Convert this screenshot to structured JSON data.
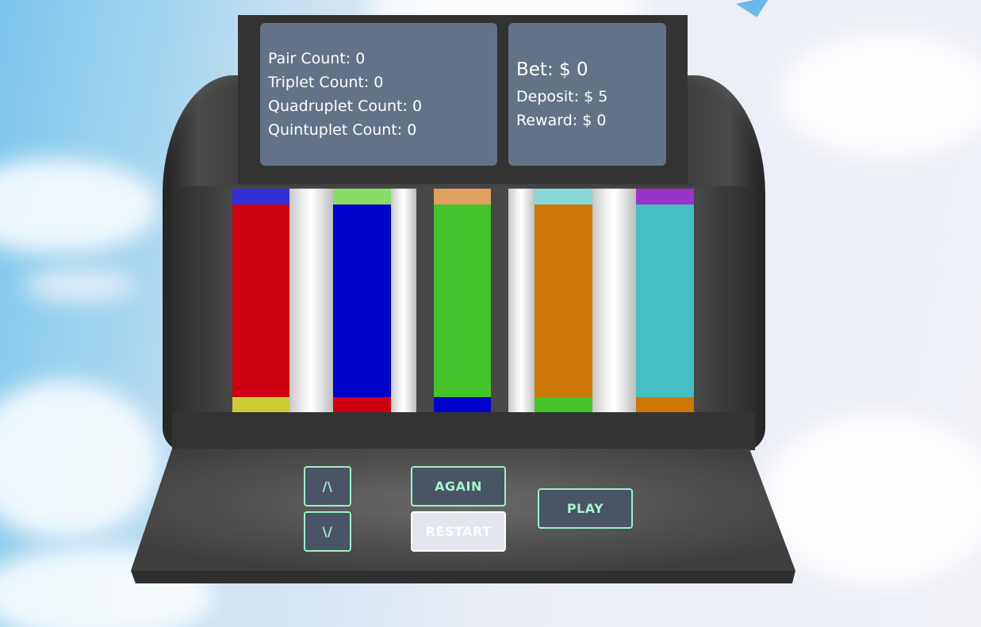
{
  "stats": {
    "pair_count": "Pair Count: 0",
    "triplet_count": "Triplet Count: 0",
    "quadruplet_count": "Quadruplet Count: 0",
    "quintuplet_count": "Quintuplet Count: 0"
  },
  "money": {
    "bet": "Bet: $ 0",
    "deposit": "Deposit: $ 5",
    "reward": "Reward: $ 0"
  },
  "reels": [
    {
      "top_color": "#3030d6",
      "main_color": "#cc0011",
      "bottom_color": "#cccc33"
    },
    {
      "top_color": "#88dd66",
      "main_color": "#0000cc",
      "bottom_color": "#cc0011"
    },
    {
      "top_color": "#e0a060",
      "main_color": "#44c42a",
      "bottom_color": "#0000cc"
    },
    {
      "top_color": "#88d8d8",
      "main_color": "#cc7708",
      "bottom_color": "#44c42a"
    },
    {
      "top_color": "#9933cc",
      "main_color": "#44bfc4",
      "bottom_color": "#cc7708"
    }
  ],
  "controls": {
    "up_label": "/\\",
    "down_label": "\\/",
    "again_label": "AGAIN",
    "restart_label": "RESTART",
    "play_label": "PLAY",
    "restart_disabled": true
  },
  "colors": {
    "panel": "#647287",
    "button_border": "#9ef0c6",
    "button_bg": "#495565",
    "machine_dark": "#333333"
  }
}
